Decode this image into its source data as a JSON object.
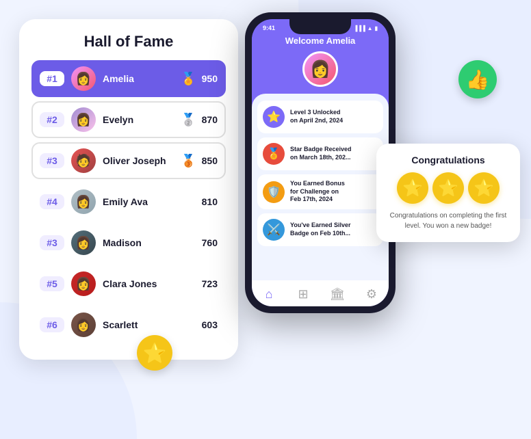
{
  "decorations": {
    "thumbs_up": "👍",
    "star": "⭐"
  },
  "hall_of_fame": {
    "title": "Hall of Fame",
    "rows": [
      {
        "rank": "#1",
        "name": "Amelia",
        "score": "950",
        "medal": "🏅",
        "avatar_class": "av1",
        "avatar_emoji": "👩",
        "style": "rank1"
      },
      {
        "rank": "#2",
        "name": "Evelyn",
        "score": "870",
        "medal": "🥈",
        "avatar_class": "av2",
        "avatar_emoji": "👩",
        "style": "rank2"
      },
      {
        "rank": "#3",
        "name": "Oliver Joseph",
        "score": "850",
        "medal": "🥉",
        "avatar_class": "av3",
        "avatar_emoji": "🧑",
        "style": "rank3"
      },
      {
        "rank": "#4",
        "name": "Emily Ava",
        "score": "810",
        "medal": "",
        "avatar_class": "av4",
        "avatar_emoji": "👩",
        "style": ""
      },
      {
        "rank": "#3",
        "name": "Madison",
        "score": "760",
        "medal": "",
        "avatar_class": "av5",
        "avatar_emoji": "👩",
        "style": ""
      },
      {
        "rank": "#5",
        "name": "Clara Jones",
        "score": "723",
        "medal": "",
        "avatar_class": "av6",
        "avatar_emoji": "👩",
        "style": ""
      },
      {
        "rank": "#6",
        "name": "Scarlett",
        "score": "603",
        "medal": "",
        "avatar_class": "av7",
        "avatar_emoji": "👩",
        "style": ""
      }
    ]
  },
  "phone": {
    "status_time": "9:41",
    "welcome_text": "Welcome Amelia",
    "activities": [
      {
        "icon": "⭐",
        "icon_class": "ai1",
        "text": "Level 3 Unlocked\non April 2nd, 2024"
      },
      {
        "icon": "🏅",
        "icon_class": "ai2",
        "text": "Star Badge Received\non March 18th, 202..."
      },
      {
        "icon": "🛡️",
        "icon_class": "ai3",
        "text": "You Earned Bonus\nfor Challenge on\nFeb 17th, 2024"
      },
      {
        "icon": "⚔️",
        "icon_class": "ai4",
        "text": "You've Earned Silver\nBadge on Feb 10th..."
      }
    ]
  },
  "congrats": {
    "title": "Congratulations",
    "stars": [
      "⭐",
      "⭐",
      "⭐"
    ],
    "text": "Congratulations on completing the first level. You won a new badge!"
  }
}
